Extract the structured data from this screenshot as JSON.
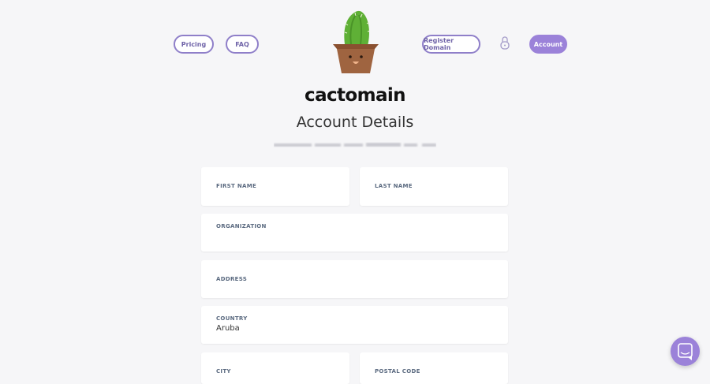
{
  "nav": {
    "pricing": "Pricing",
    "faq": "FAQ",
    "register": "Register Domain",
    "account": "Account",
    "lock_icon": "lock-icon"
  },
  "brand": {
    "name": "cactomain"
  },
  "page": {
    "title": "Account Details"
  },
  "form": {
    "first_name": {
      "label": "FIRST NAME",
      "value": ""
    },
    "last_name": {
      "label": "LAST NAME",
      "value": ""
    },
    "organization": {
      "label": "ORGANIZATION",
      "value": ""
    },
    "address": {
      "label": "ADDRESS",
      "value": ""
    },
    "country": {
      "label": "COUNTRY",
      "value": "Aruba"
    },
    "city": {
      "label": "CITY",
      "value": ""
    },
    "postal_code": {
      "label": "POSTAL CODE",
      "value": ""
    }
  },
  "chat": {
    "icon": "chat-icon"
  },
  "colors": {
    "accent": "#9b82d9",
    "outline": "#8f7fc9",
    "background": "#f6f6f8"
  }
}
